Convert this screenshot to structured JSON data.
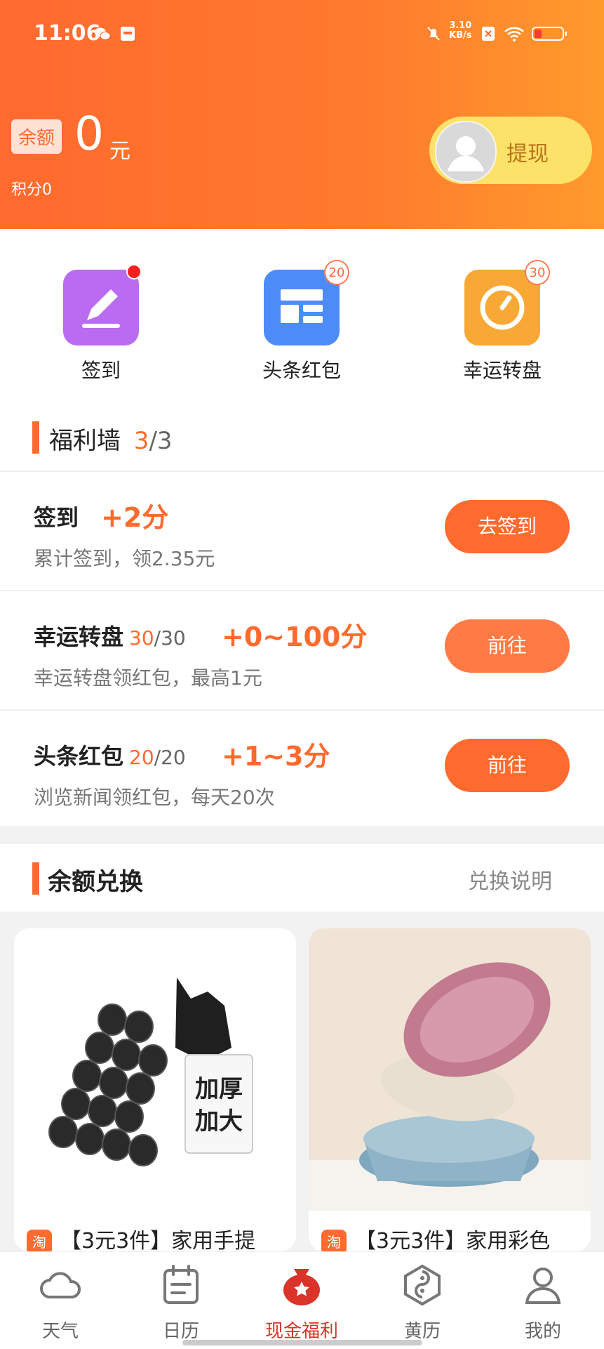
{
  "status": {
    "time": "11:06",
    "net_speed_value": "3.10",
    "net_speed_unit": "KB/s"
  },
  "header": {
    "balance_label": "余额",
    "balance_value": "0",
    "balance_unit": "元",
    "points": "积分0",
    "withdraw_label": "提现"
  },
  "quick": [
    {
      "label": "签到",
      "color": "#b96cf2",
      "icon": "pencil-icon"
    },
    {
      "label": "头条红包",
      "color": "#4d8cf8",
      "icon": "news-layout-icon",
      "badge": "20"
    },
    {
      "label": "幸运转盘",
      "color": "#f8a834",
      "icon": "dial-icon",
      "badge": "30"
    }
  ],
  "wall": {
    "title": "福利墙",
    "done": "3",
    "total": "/3"
  },
  "tasks": [
    {
      "name": "签到",
      "count_done": "",
      "count_total": "",
      "reward": "+2分",
      "desc": "累计签到，领2.35元",
      "button": "去签到"
    },
    {
      "name": "幸运转盘",
      "count_done": "30",
      "count_total": "/30",
      "reward": "+0~100分",
      "desc": "幸运转盘领红包，最高1元",
      "button": "前往"
    },
    {
      "name": "头条红包",
      "count_done": "20",
      "count_total": "/20",
      "reward": "+1~3分",
      "desc": "浏览新闻领红包，每天20次",
      "button": "前往"
    }
  ],
  "exchange": {
    "title": "余额兑换",
    "link": "兑换说明"
  },
  "products": [
    {
      "tag": "淘",
      "title": "【3元3件】家用手提",
      "image_text": "加厚\n加大"
    },
    {
      "tag": "淘",
      "title": "【3元3件】家用彩色"
    }
  ],
  "tabs": [
    {
      "label": "天气",
      "icon": "cloud-icon"
    },
    {
      "label": "日历",
      "icon": "calendar-icon"
    },
    {
      "label": "现金福利",
      "icon": "money-bag-icon"
    },
    {
      "label": "黄历",
      "icon": "yin-yang-icon"
    },
    {
      "label": "我的",
      "icon": "user-icon"
    }
  ],
  "colors": {
    "accent": "#ff6a2e",
    "active_tab": "#d9332a",
    "withdraw_bg": "#fce269"
  }
}
